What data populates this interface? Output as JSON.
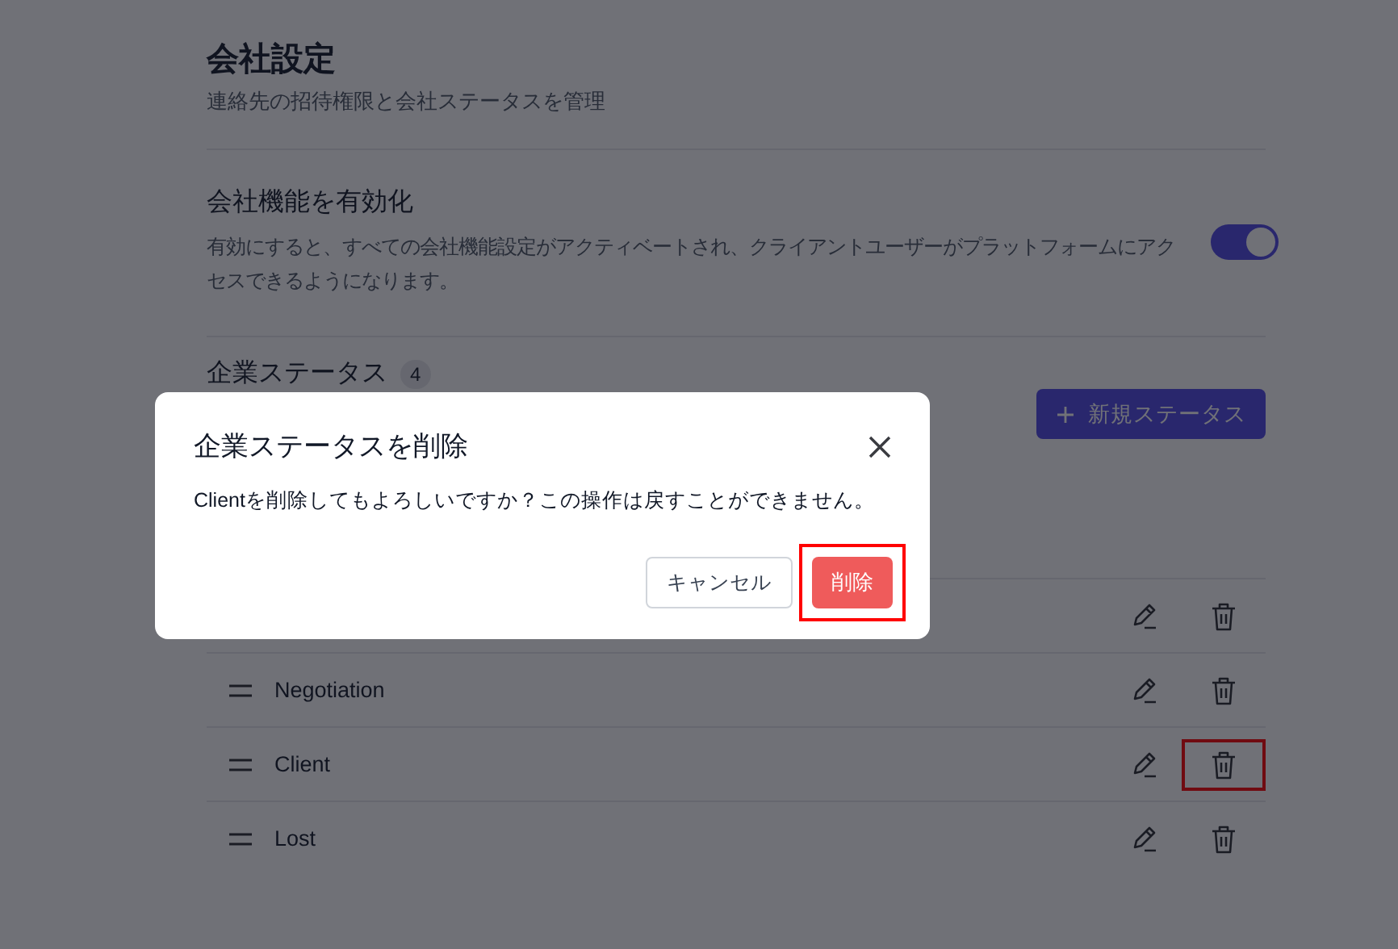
{
  "page": {
    "title": "会社設定",
    "subtitle": "連絡先の招待権限と会社ステータスを管理"
  },
  "feature": {
    "title": "会社機能を有効化",
    "description": "有効にすると、すべての会社機能設定がアクティベートされ、クライアントユーザーがプラットフォームにアクセスできるようになります。",
    "on": true
  },
  "statuses": {
    "title": "企業ステータス",
    "count": "4",
    "new_button": "新規ステータス",
    "rows": [
      {
        "highlighted": false
      },
      {
        "name": "Negotiation",
        "highlighted": false
      },
      {
        "name": "Client",
        "highlighted": true
      },
      {
        "name": "Lost",
        "highlighted": false
      }
    ]
  },
  "dialog": {
    "title": "企業ステータスを削除",
    "message": "Clientを削除してもよろしいですか？この操作は戻すことができません。",
    "cancel": "キャンセル",
    "confirm": "削除",
    "confirm_highlighted": true
  }
}
